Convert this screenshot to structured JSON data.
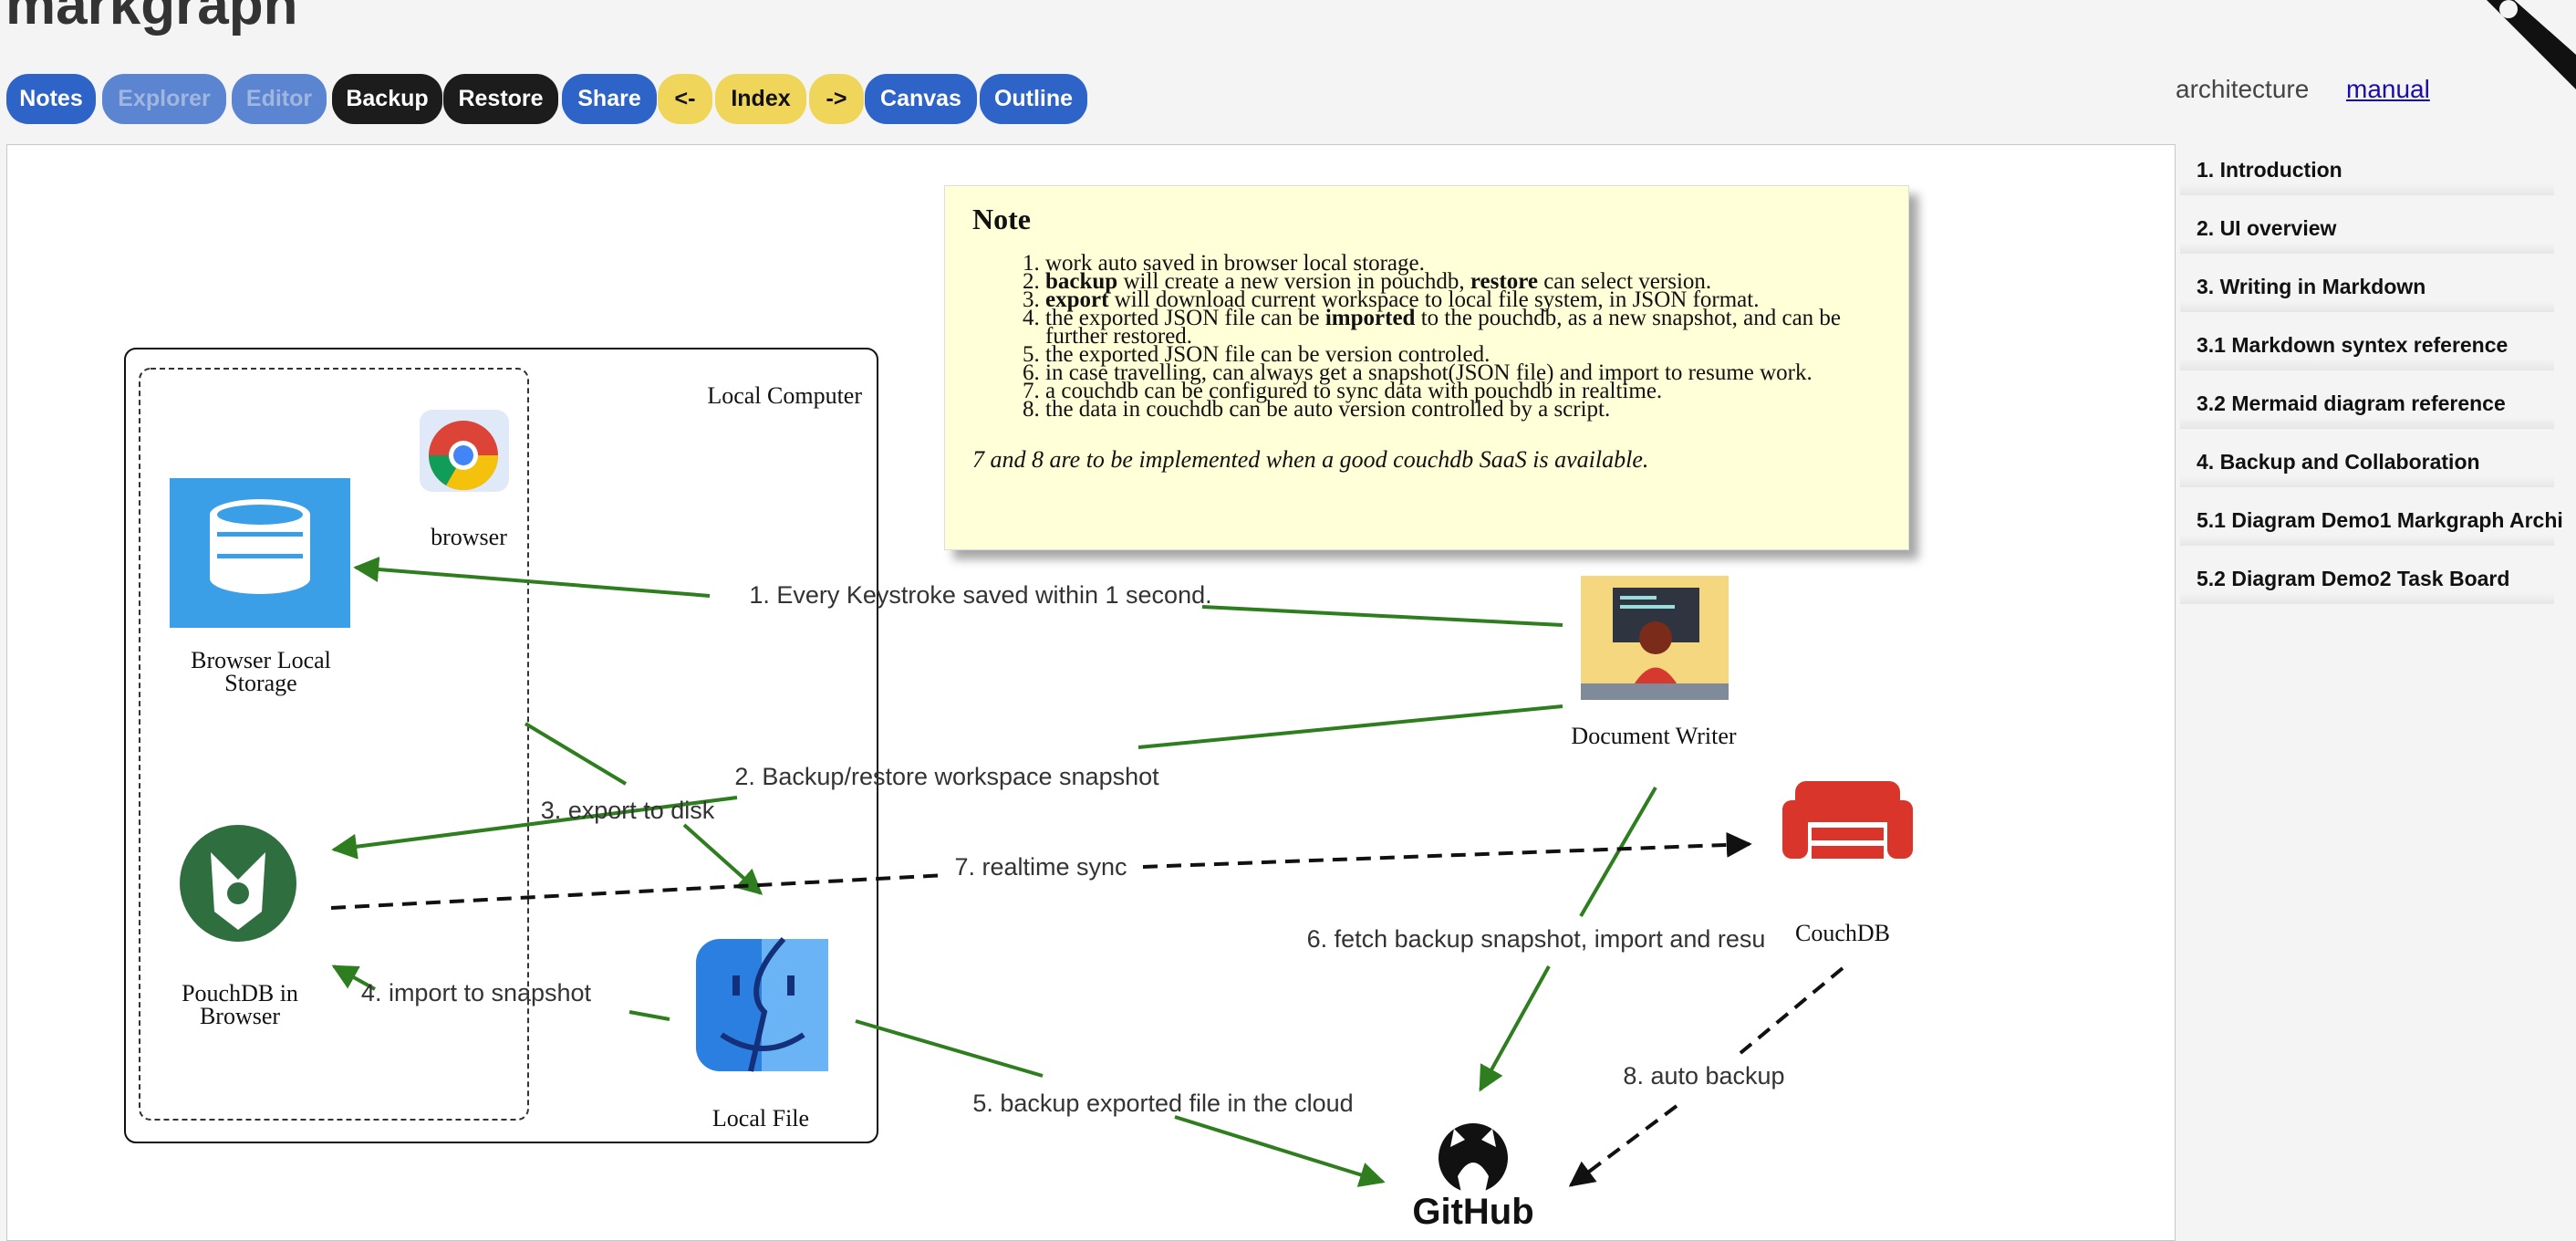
{
  "app": {
    "title": "markgraph"
  },
  "toolbar": {
    "buttons": [
      {
        "label": "Notes"
      },
      {
        "label": "Explorer"
      },
      {
        "label": "Editor"
      },
      {
        "label": "Backup"
      },
      {
        "label": "Restore"
      },
      {
        "label": "Share"
      },
      {
        "label": "<-"
      },
      {
        "label": "Index"
      },
      {
        "label": "->"
      },
      {
        "label": "Canvas"
      },
      {
        "label": "Outline"
      }
    ]
  },
  "topnav": {
    "architecture": "architecture",
    "manual": "manual"
  },
  "note": {
    "title": "Note",
    "items": [
      {
        "pre": "work auto saved in browser local storage.",
        "b1": "",
        "mid": "",
        "b2": "",
        "post": ""
      },
      {
        "pre": "",
        "b1": "backup",
        "mid": " will create a new version in pouchdb, ",
        "b2": "restore",
        "post": " can select version."
      },
      {
        "pre": "",
        "b1": "export",
        "mid": " will download current workspace to local file system, in JSON format.",
        "b2": "",
        "post": ""
      },
      {
        "pre": "the exported JSON file can be ",
        "b1": "imported",
        "mid": " to the pouchdb, as a new snapshot, and can be further restored.",
        "b2": "",
        "post": ""
      },
      {
        "pre": "the exported JSON file can be version controled.",
        "b1": "",
        "mid": "",
        "b2": "",
        "post": ""
      },
      {
        "pre": "in case travelling, can always get a snapshot(JSON file) and import to resume work.",
        "b1": "",
        "mid": "",
        "b2": "",
        "post": ""
      },
      {
        "pre": "a couchdb can be configured to sync data with pouchdb in realtime.",
        "b1": "",
        "mid": "",
        "b2": "",
        "post": ""
      },
      {
        "pre": "the data in couchdb can be auto version controlled by a script.",
        "b1": "",
        "mid": "",
        "b2": "",
        "post": ""
      }
    ],
    "footer": "7 and 8 are to be implemented when a good couchdb SaaS is available."
  },
  "diagram": {
    "nodes": {
      "local_computer": "Local Computer",
      "browser": "browser",
      "browser_local_storage": [
        "Browser Local",
        "Storage"
      ],
      "pouchdb": [
        "PouchDB in",
        "Browser"
      ],
      "local_file": "Local File",
      "document_writer": "Document Writer",
      "couchdb": "CouchDB",
      "github": "GitHub"
    },
    "edges": {
      "e1": "1. Every Keystroke saved within 1 second.",
      "e2": "2. Backup/restore workspace snapshot",
      "e3": "3. export to disk",
      "e4": "4. import to snapshot",
      "e5": "5. backup exported file in the cloud",
      "e6": "6. fetch backup snapshot, import and resu",
      "e7": "7. realtime sync",
      "e8": "8. auto backup"
    },
    "colors": {
      "edge_green": "#2e7d1e",
      "edge_black": "#111111"
    }
  },
  "sidebar": {
    "items": [
      {
        "label": "1. Introduction"
      },
      {
        "label": "2. UI overview"
      },
      {
        "label": "3. Writing in Markdown"
      },
      {
        "label": "3.1 Markdown syntex reference"
      },
      {
        "label": "3.2 Mermaid diagram reference"
      },
      {
        "label": "4. Backup and Collaboration"
      },
      {
        "label": "5.1 Diagram Demo1 Markgraph Archi"
      },
      {
        "label": "5.2 Diagram Demo2 Task Board"
      }
    ]
  },
  "colors": {
    "primary": "#2e63c8",
    "dark": "#1c1c1c",
    "yellow": "#efd65a",
    "note_bg": "#ffffd8"
  }
}
